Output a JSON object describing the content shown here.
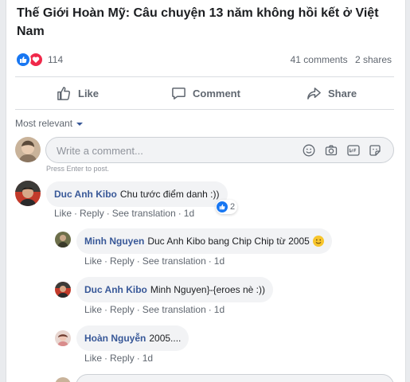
{
  "post": {
    "title": "Thế Giới Hoàn Mỹ: Câu chuyện 13 năm không hồi kết ở Việt Nam"
  },
  "reactions": {
    "count": "114",
    "comments": "41 comments",
    "shares": "2 shares",
    "types": [
      "like-icon",
      "love-icon"
    ]
  },
  "actions": {
    "like": "Like",
    "comment": "Comment",
    "share": "Share"
  },
  "sort": {
    "label": "Most relevant"
  },
  "composer": {
    "placeholder": "Write a comment...",
    "hint": "Press Enter to post.",
    "icons": [
      "emoji-icon",
      "camera-icon",
      "gif-icon",
      "sticker-icon"
    ]
  },
  "comments": [
    {
      "author": "Duc Anh Kibo",
      "text": "Chu tước điểm danh :))",
      "like": "Like",
      "reply": "Reply",
      "see_translation": "See translation",
      "time": "1d",
      "reaction_count": "2",
      "replies": [
        {
          "author": "Minh Nguyen",
          "text": "Duc Anh Kibo bang Chip Chip từ 2005",
          "like": "Like",
          "reply": "Reply",
          "see_translation": "See translation",
          "time": "1d"
        },
        {
          "author": "Duc Anh Kibo",
          "text": "Minh Nguyen}-{eroes nè :))",
          "like": "Like",
          "reply": "Reply",
          "see_translation": "See translation",
          "time": "1d"
        },
        {
          "author": "Hoàn Nguyễn",
          "text": "2005....",
          "like": "Like",
          "reply": "Reply",
          "time": "1d"
        }
      ]
    }
  ],
  "colors": {
    "link": "#385898",
    "like_blue": "#1877f2",
    "love_red": "#f0284a",
    "muted": "#606770"
  }
}
